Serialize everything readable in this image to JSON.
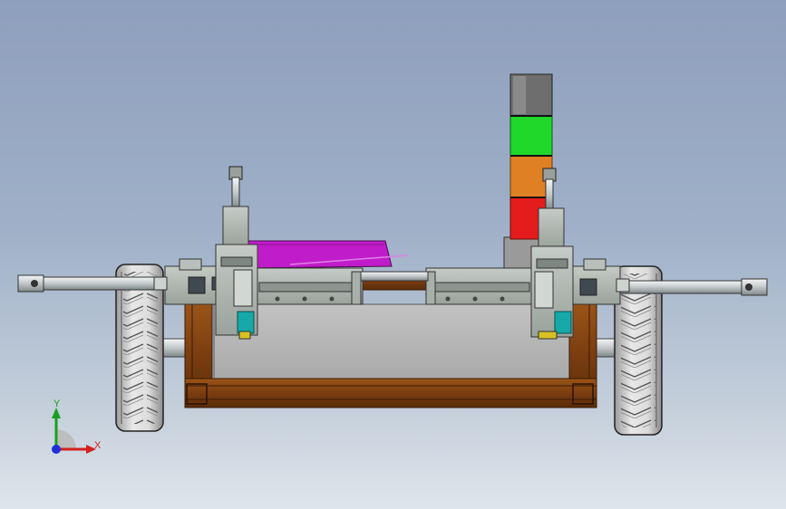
{
  "axes": {
    "x_label": "X",
    "y_label": "Y",
    "x_color": "#d42020",
    "y_color": "#18a020",
    "z_color": "#1f2fd8"
  },
  "colors": {
    "frame": "#7a3d10",
    "frame_edge": "#3a1a05",
    "body_panel": "#b6b6b6",
    "magenta_part": "#c11cc9",
    "tower_gray": "#777777",
    "tower_green": "#1fd82a",
    "tower_orange": "#e08024",
    "tower_red": "#e41c1c",
    "tire": "#dadada",
    "steel": "#c8ced0",
    "teal_block": "#17a9a9"
  },
  "icons": [
    "coordinate-triad-icon"
  ]
}
